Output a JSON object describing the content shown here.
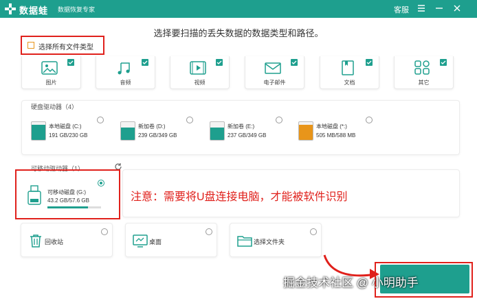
{
  "titlebar": {
    "app_name": "数据蛙",
    "subtitle": "数据恢复专家",
    "support": "客服",
    "menu_icon": "menu-icon",
    "min_icon": "minimize-icon",
    "close_icon": "close-icon"
  },
  "heading": "选择要扫描的丢失数据的数据类型和路径。",
  "select_all": {
    "label": "选择所有文件类型",
    "checked": false
  },
  "file_types": [
    {
      "label": "图片",
      "icon": "image-icon",
      "checked": true
    },
    {
      "label": "音频",
      "icon": "music-icon",
      "checked": true
    },
    {
      "label": "视频",
      "icon": "video-icon",
      "checked": true
    },
    {
      "label": "电子邮件",
      "icon": "email-icon",
      "checked": true
    },
    {
      "label": "文档",
      "icon": "document-icon",
      "checked": true
    },
    {
      "label": "其它",
      "icon": "other-icon",
      "checked": true
    }
  ],
  "hdd_section": {
    "title": "硬盘驱动器（4）",
    "drives": [
      {
        "name": "本地磁盘 (C:)",
        "size": "191 GB/230 GB",
        "used_fraction": 0.83,
        "color": "#1e9f8e"
      },
      {
        "name": "新加卷 (D:)",
        "size": "239 GB/349 GB",
        "used_fraction": 0.68,
        "color": "#1e9f8e"
      },
      {
        "name": "新加卷 (E:)",
        "size": "237 GB/349 GB",
        "used_fraction": 0.68,
        "color": "#1e9f8e"
      },
      {
        "name": "本地磁盘 (*:)",
        "size": "505 MB/588 MB",
        "used_fraction": 0.86,
        "color": "#e8951a"
      }
    ]
  },
  "removable_section": {
    "title": "可移动驱动器（1）",
    "refresh_icon": "refresh-icon",
    "drives": [
      {
        "name": "可移动磁盘 (G:)",
        "size": "43.2 GB/57.6 GB",
        "used_fraction": 0.75,
        "selected": true
      }
    ]
  },
  "notice": "注意：需要将U盘连接电脑，才能被软件识别",
  "locations": [
    {
      "label": "回收站",
      "icon": "trash-icon"
    },
    {
      "label": "桌面",
      "icon": "desktop-icon"
    },
    {
      "label": "选择文件夹",
      "icon": "folder-icon"
    }
  ],
  "watermark": "掘金技术社区 @ 小明助手",
  "colors": {
    "accent": "#1e9f8e",
    "highlight": "#e0201b",
    "orange": "#e8951a"
  }
}
